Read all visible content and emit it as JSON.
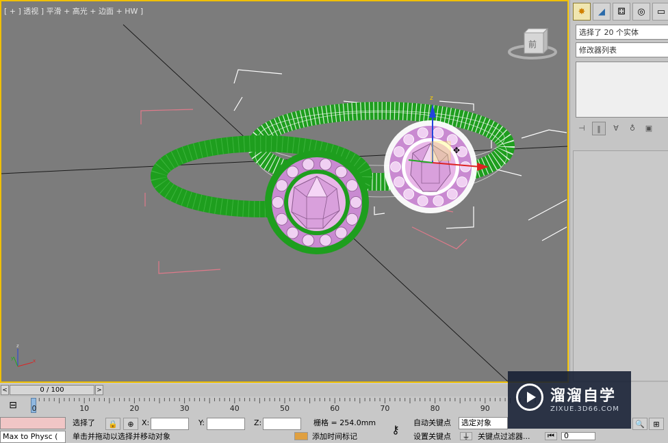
{
  "viewport": {
    "label": "[ + ] 透视 ] 平滑 + 高光 + 边面 + HW ]",
    "cube_label": "前",
    "colors": {
      "ring": "#1e9e1e",
      "selected_wire": "#ffffff",
      "gem": "#e8b6e8",
      "bezel": "#c98ad1",
      "bbox": "#e07a8a"
    }
  },
  "command_panel": {
    "tabs": [
      {
        "icon": "create-icon",
        "glyph": "✸"
      },
      {
        "icon": "modify-icon",
        "glyph": "◢"
      },
      {
        "icon": "hierarchy-icon",
        "glyph": "⚃"
      },
      {
        "icon": "motion-icon",
        "glyph": "◎"
      },
      {
        "icon": "display-icon",
        "glyph": "▭"
      }
    ],
    "selection_text": "选择了 20 个实体",
    "modifier_list": "修改器列表"
  },
  "time_slider": {
    "prev": "<",
    "next": ">",
    "frame": "0 / 100"
  },
  "trackbar": {
    "labels": [
      "0",
      "10",
      "20",
      "30",
      "40",
      "50",
      "60",
      "70",
      "80",
      "90"
    ]
  },
  "status": {
    "script_listener": "Max to Physc (",
    "selected_label": "选择了",
    "x_label": "X:",
    "y_label": "Y:",
    "z_label": "Z:",
    "grid": "栅格 = 254.0mm",
    "prompt": "单击并拖动以选择并移动对象",
    "add_time_tag": "添加时间标记",
    "auto_key": "自动关键点",
    "set_key": "设置关键点",
    "selected_object": "选定对象",
    "key_filters": "关键点过滤器...",
    "frame_field": "0"
  },
  "watermark": {
    "title": "溜溜自学",
    "subtitle": "ZIXUE.3D66.COM"
  }
}
